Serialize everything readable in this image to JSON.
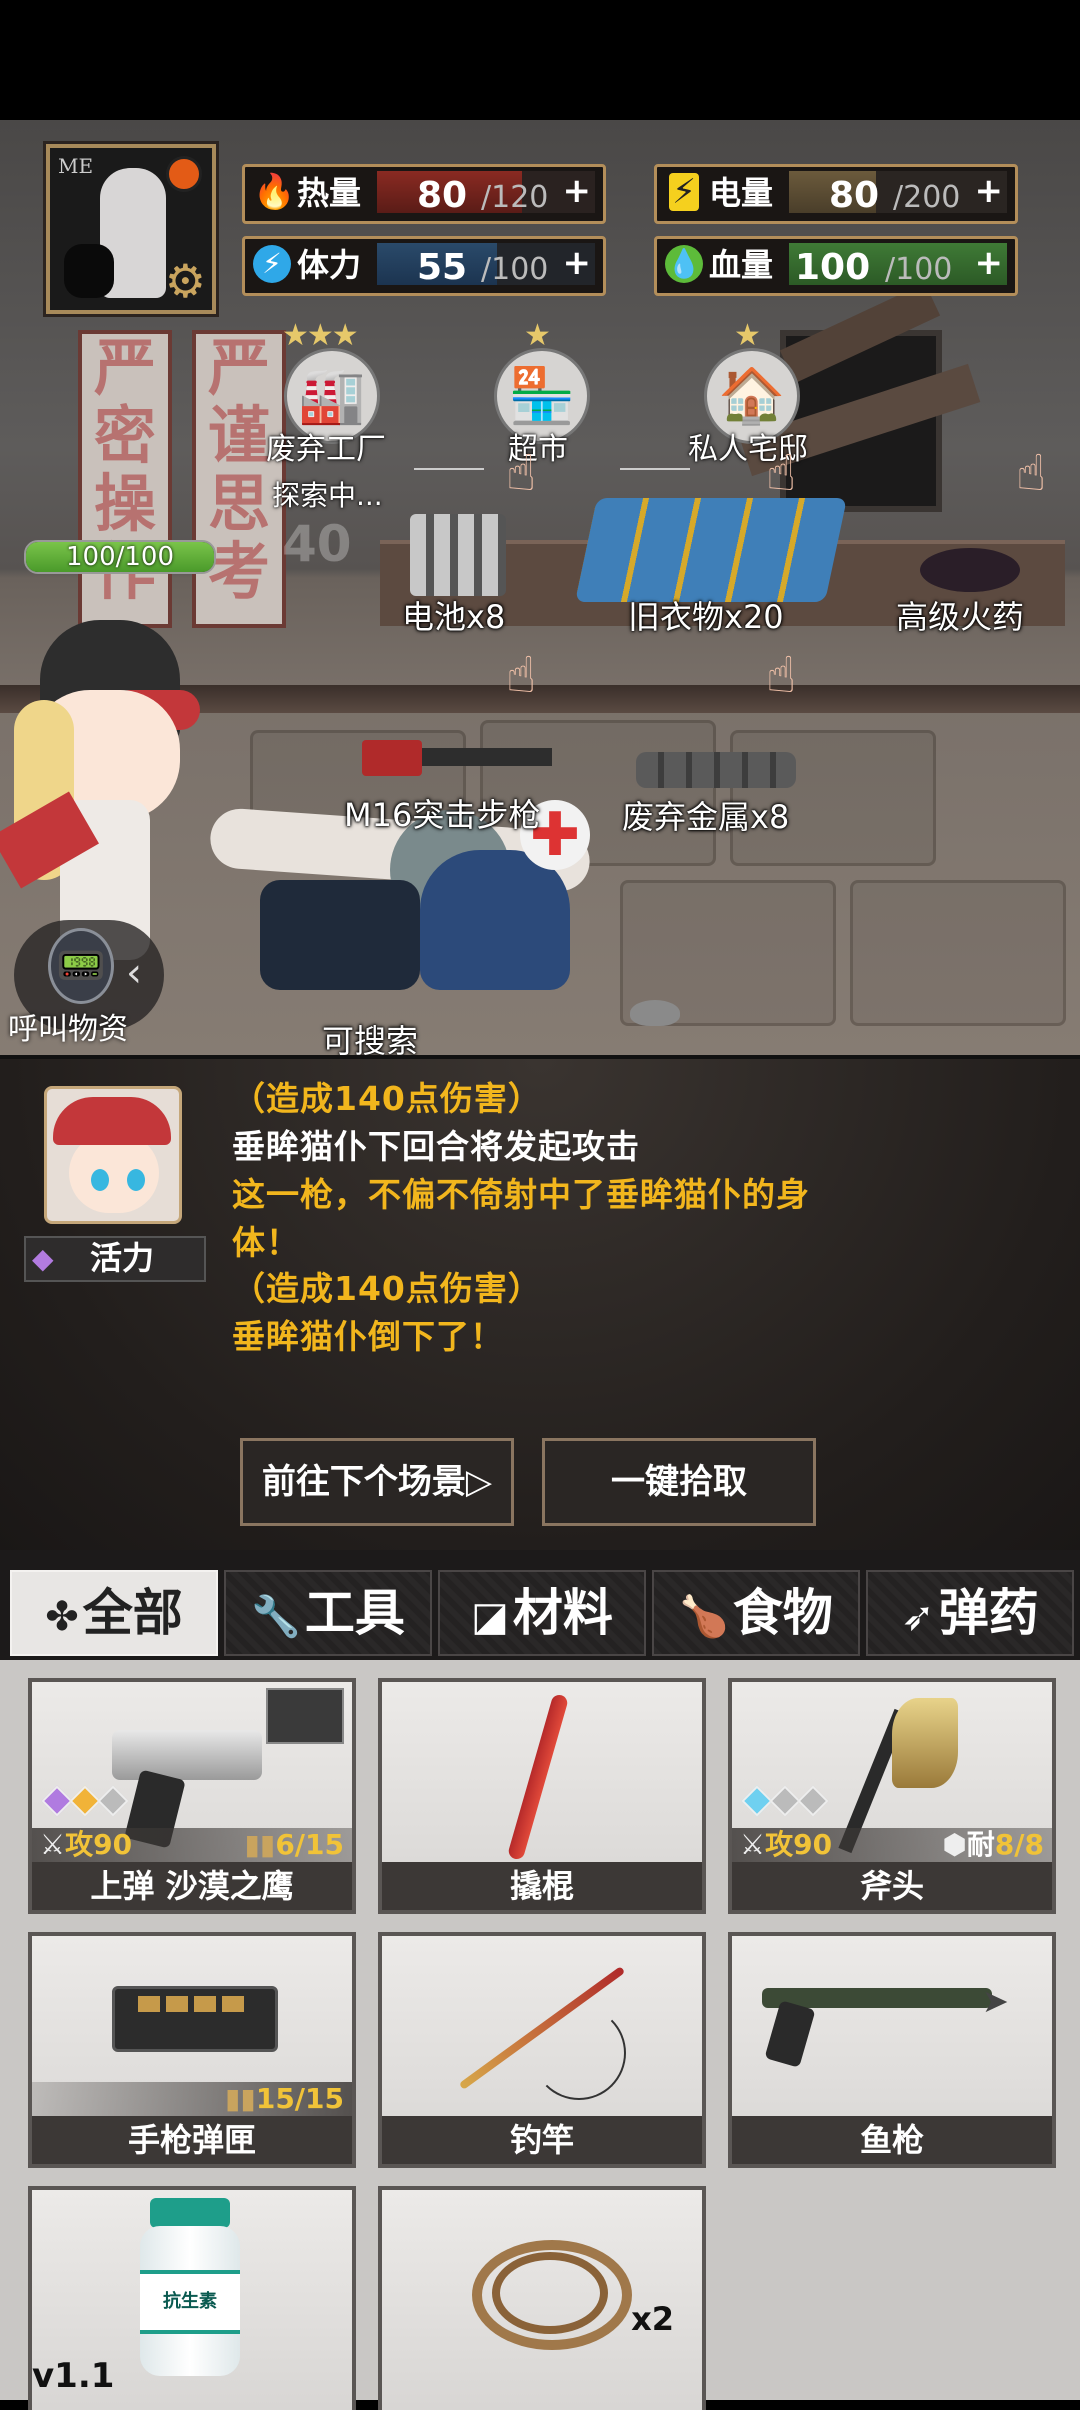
{
  "avatar": {
    "badge": "ME"
  },
  "stats": {
    "heat": {
      "label": "热量",
      "current": "80",
      "max": "/120",
      "fill": 0.667,
      "color": "#e8442e",
      "icon": "flame-icon"
    },
    "power": {
      "label": "电量",
      "current": "80",
      "max": "/200",
      "fill": 0.4,
      "color": "#f5d01e",
      "icon": "battery-icon"
    },
    "stamina": {
      "label": "体力",
      "current": "55",
      "max": "/100",
      "fill": 0.55,
      "color": "#2fa8e8",
      "icon": "lightning-icon"
    },
    "health": {
      "label": "血量",
      "current": "100",
      "max": "/100",
      "fill": 1.0,
      "color": "#5dbb3a",
      "icon": "blood-drop-icon"
    },
    "plus": "+"
  },
  "banners": {
    "left": [
      "严",
      "密",
      "操",
      "作"
    ],
    "right": [
      "严",
      "谨",
      "思",
      "考"
    ]
  },
  "locations": [
    {
      "name": "废弃工厂",
      "status": "探索中...",
      "stars": "★★★",
      "icon": "factory-icon"
    },
    {
      "name": "超市",
      "stars": "★",
      "icon": "store-icon"
    },
    {
      "name": "私人宅邸",
      "stars": "★",
      "icon": "house-icon"
    }
  ],
  "player_hp": {
    "text": "100/100",
    "fill": 1.0
  },
  "scene_items": {
    "battery": "电池x8",
    "clothes": "旧衣物x20",
    "gunpowder": "高级火药",
    "rifle": "M16突击步枪",
    "metal": "废弃金属x8",
    "searchable": "可搜索",
    "faded_number": "40"
  },
  "call_supply": "呼叫物资",
  "trait": {
    "label": "活力"
  },
  "log": [
    {
      "text": "（造成140点伤害）",
      "color": "#f2b61d"
    },
    {
      "text": "垂眸猫仆下回合将发起攻击",
      "color": "#ffffff"
    },
    {
      "text": "这一枪，不偏不倚射中了垂眸猫仆的身",
      "color": "#f2b61d"
    },
    {
      "text": "体！",
      "color": "#f2b61d"
    },
    {
      "text": "（造成140点伤害）",
      "color": "#f2b61d"
    },
    {
      "text": "垂眸猫仆倒下了！",
      "color": "#f2b61d"
    }
  ],
  "buttons": {
    "next_scene": "前往下个场景▷",
    "pickup_all": "一键拾取"
  },
  "tabs": [
    {
      "label": "全部",
      "icon": "clover-icon",
      "active": true
    },
    {
      "label": "工具",
      "icon": "wrench-icon"
    },
    {
      "label": "材料",
      "icon": "material-icon"
    },
    {
      "label": "食物",
      "icon": "meat-icon"
    },
    {
      "label": "弹药",
      "icon": "bullet-icon"
    }
  ],
  "inventory": [
    {
      "name": "上弹 沙漠之鹰",
      "attack": "攻90",
      "ammo": "6/15"
    },
    {
      "name": "撬棍"
    },
    {
      "name": "斧头",
      "attack": "攻90",
      "durability_label": "耐",
      "durability": "8/8"
    },
    {
      "name": "手枪弹匣",
      "ammo": "15/15"
    },
    {
      "name": "钓竿"
    },
    {
      "name": "鱼枪"
    },
    {
      "name": "",
      "label_on_item": "抗生素"
    },
    {
      "name": "",
      "count": "x2"
    }
  ],
  "version": "v1.1"
}
